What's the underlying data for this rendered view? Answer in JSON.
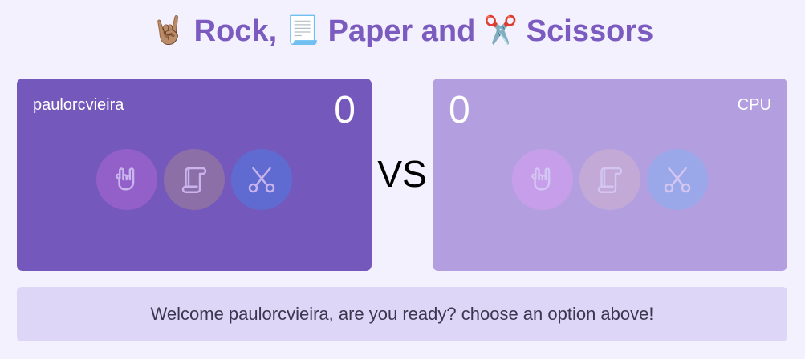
{
  "header": {
    "emoji_rock": "🤘🏽",
    "word_rock": "Rock,",
    "emoji_paper": "📃",
    "word_paper": "Paper and",
    "emoji_scissors": "✂️",
    "word_scissors": "Scissors"
  },
  "player": {
    "name": "paulorcvieira",
    "score": "0",
    "options": [
      "rock-icon",
      "paper-icon",
      "scissors-icon"
    ]
  },
  "cpu": {
    "name": "CPU",
    "score": "0",
    "options": [
      "rock-icon",
      "paper-icon",
      "scissors-icon"
    ]
  },
  "versus": "VS",
  "message": "Welcome paulorcvieira, are you ready? choose an option above!",
  "colors": {
    "title": "#7b5bbf",
    "player_panel": "#7558bb",
    "cpu_panel": "#b39fe0",
    "background": "#f3f1fd",
    "message_bg": "#ddd6f6"
  }
}
